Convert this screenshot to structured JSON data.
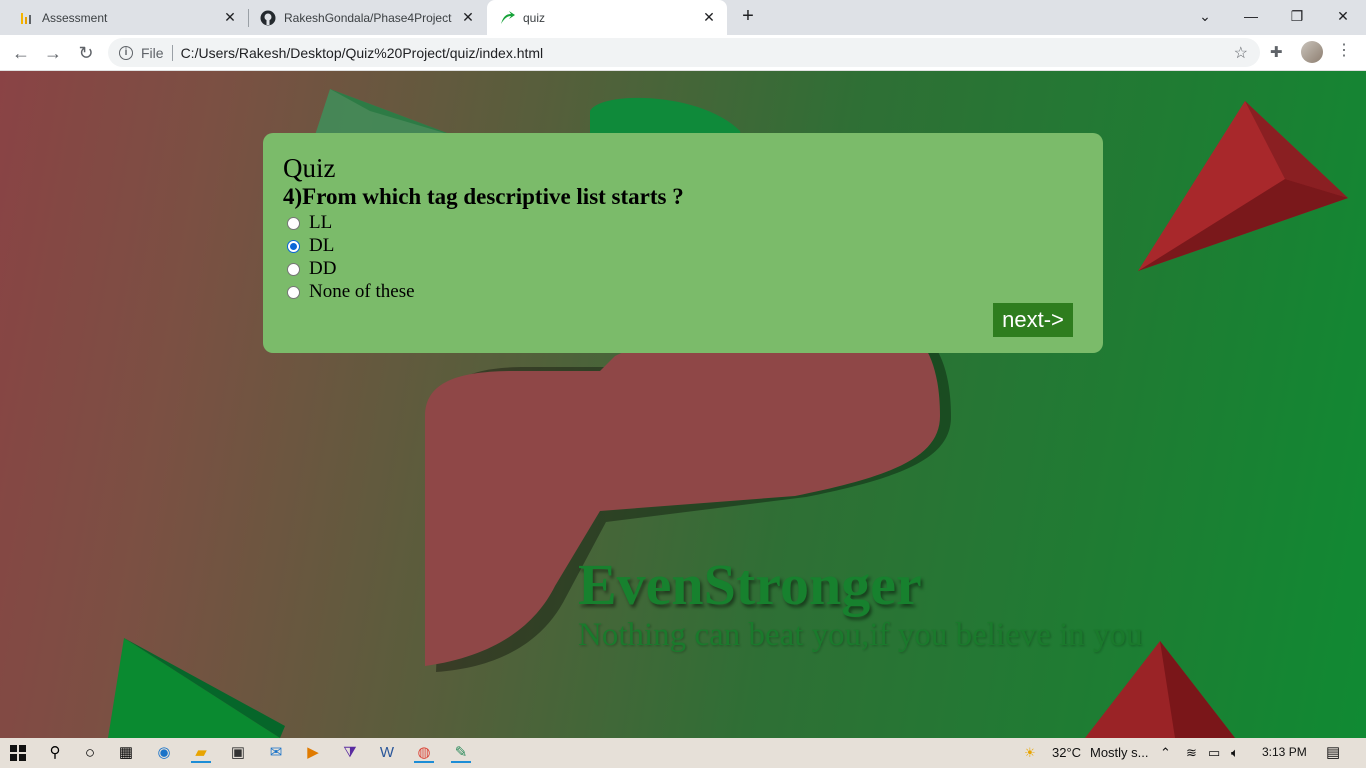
{
  "browser": {
    "tabs": [
      {
        "title": "Assessment",
        "icon": "chart-favicon-icon"
      },
      {
        "title": "RakeshGondala/Phase4Project",
        "icon": "github-favicon-icon"
      },
      {
        "title": "quiz",
        "icon": "green-arrow-favicon-icon",
        "active": true
      }
    ],
    "address": {
      "scheme_label": "File",
      "url": "C:/Users/Rakesh/Desktop/Quiz%20Project/quiz/index.html"
    }
  },
  "quiz": {
    "title": "Quiz",
    "question": "4)From which tag descriptive list starts ?",
    "options": [
      "LL",
      "DL",
      "DD",
      "None of these"
    ],
    "selected_index": 1,
    "next_label": "next->"
  },
  "background": {
    "brand_title": "EvenStronger",
    "tagline": "Nothing can beat you,if you believe in you"
  },
  "taskbar": {
    "weather_temp": "32°C",
    "weather_text": "Mostly s...",
    "time": "3:13 PM"
  },
  "colors": {
    "card": "#7bbb6a",
    "next_button": "#2e7d1e",
    "brand_green": "#17812e",
    "pyramid_red": "#a8282b"
  }
}
